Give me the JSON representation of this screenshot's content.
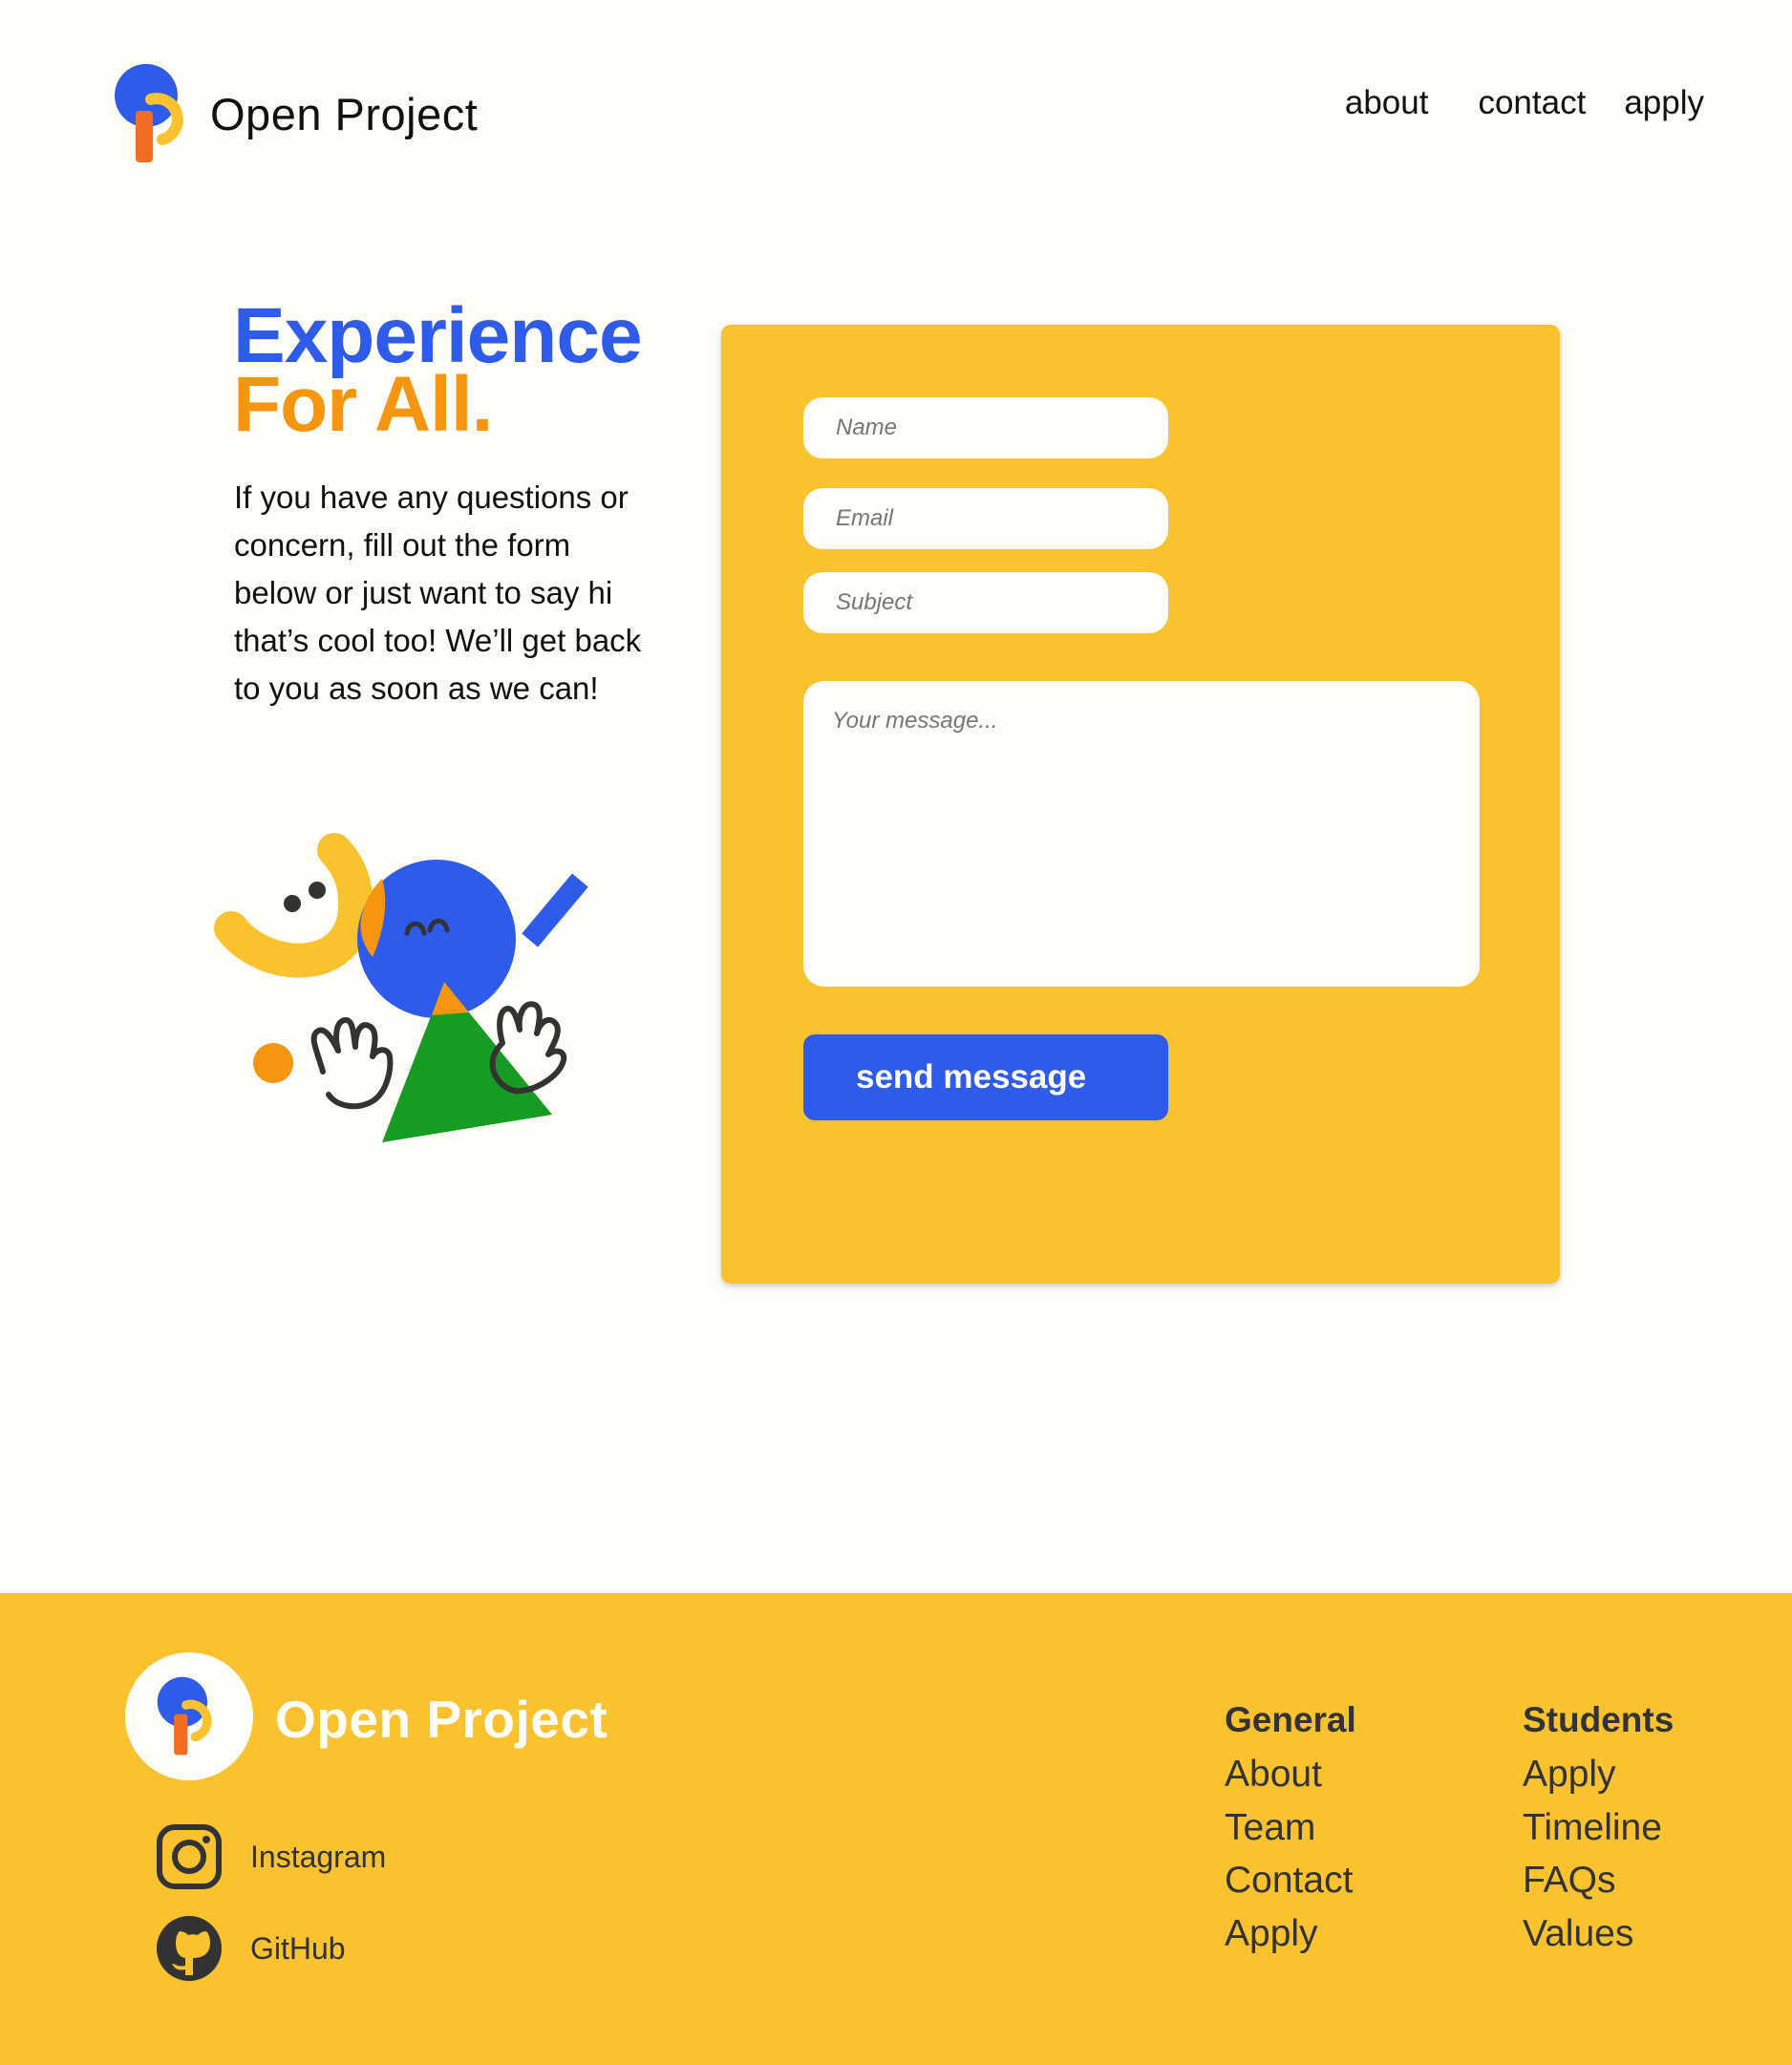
{
  "header": {
    "brand": "Open Project",
    "nav": {
      "about": "about",
      "contact": "contact",
      "apply": "apply"
    }
  },
  "hero": {
    "headline_line1": "Experience",
    "headline_line2": "For All.",
    "intro": "If you have any questions or concern, fill out the form below or just want to say hi that’s cool too! We’ll get back to you as soon as we can!"
  },
  "form": {
    "name_placeholder": "Name",
    "email_placeholder": "Email",
    "subject_placeholder": "Subject",
    "message_placeholder": "Your message...",
    "send_label": "send message"
  },
  "footer": {
    "brand": "Open Project",
    "social": {
      "instagram": "Instagram",
      "github": "GitHub"
    },
    "general": {
      "title": "General",
      "links": [
        "About",
        "Team",
        "Contact",
        "Apply"
      ]
    },
    "students": {
      "title": "Students",
      "links": [
        "Apply",
        "Timeline",
        "FAQs",
        "Values"
      ]
    }
  },
  "colors": {
    "blue": "#2f5bea",
    "orange": "#f6950f",
    "yellow": "#f9c22e",
    "cream": "#fefdf8",
    "green": "#169c22"
  },
  "icons": [
    "open-project-logo-icon",
    "instagram-icon",
    "github-icon"
  ]
}
